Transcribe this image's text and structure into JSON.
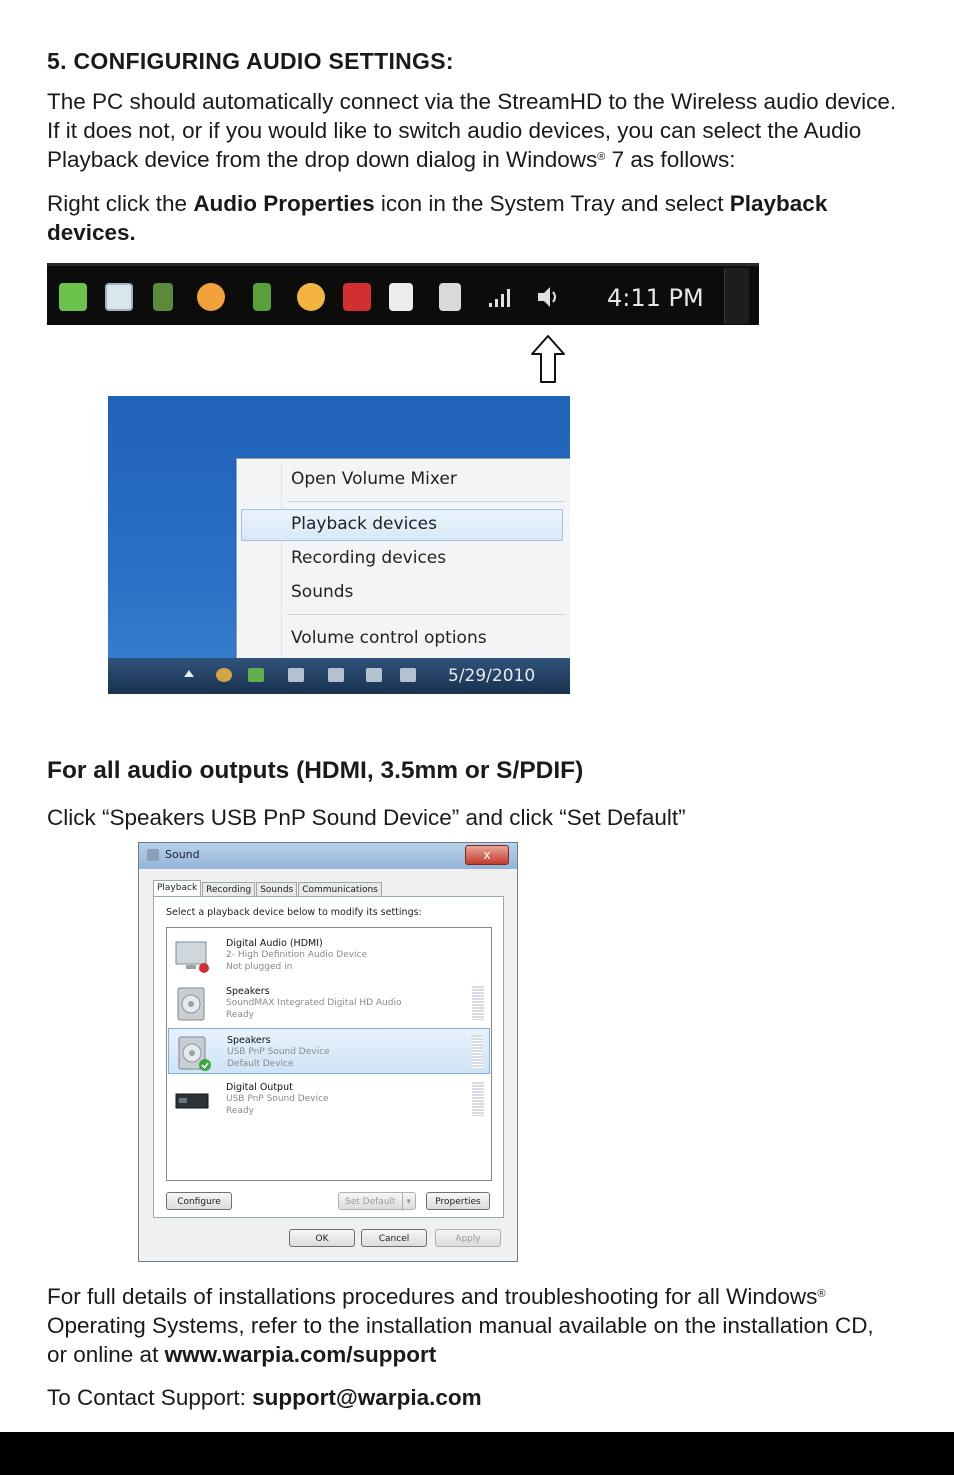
{
  "heading": "5. CONFIGURING  AUDIO SETTINGS:",
  "intro": {
    "line1": "The PC should automatically connect via the StreamHD to the Wireless audio device.",
    "line2": "If it does not, or if you would like to switch audio devices, you can select the Audio",
    "line3_pre": "Playback device from the drop down dialog in Windows",
    "reg": "®",
    "line3_post": " 7 as follows:"
  },
  "instruction": {
    "pre": "Right click the ",
    "bold1": "Audio Properties",
    "mid": " icon in the System Tray and select ",
    "bold2": "Playback",
    "bold3": "devices."
  },
  "tray": {
    "time": "4:11 PM"
  },
  "context_menu": {
    "items": [
      "Open Volume Mixer",
      "Playback devices",
      "Recording devices",
      "Sounds",
      "Volume control options"
    ],
    "date": "5/29/2010"
  },
  "section2": {
    "heading": "For all audio outputs (HDMI, 3.5mm or S/PDIF)",
    "instruction": "Click “Speakers USB PnP Sound Device” and click “Set Default”"
  },
  "sound_dialog": {
    "title": "Sound",
    "close": "x",
    "tabs": [
      "Playback",
      "Recording",
      "Sounds",
      "Communications"
    ],
    "instruction": "Select a playback device below to modify its settings:",
    "devices": [
      {
        "name": "Digital Audio (HDMI)",
        "sub": "2- High Definition Audio Device",
        "status": "Not plugged in"
      },
      {
        "name": "Speakers",
        "sub": "SoundMAX Integrated Digital HD Audio",
        "status": "Ready"
      },
      {
        "name": "Speakers",
        "sub": "USB PnP Sound Device",
        "status": "Default Device"
      },
      {
        "name": "Digital Output",
        "sub": "USB PnP Sound Device",
        "status": "Ready"
      }
    ],
    "buttons": {
      "configure": "Configure",
      "set_default": "Set Default",
      "properties": "Properties",
      "ok": "OK",
      "cancel": "Cancel",
      "apply": "Apply"
    }
  },
  "footer": {
    "line1_pre": "For full details of installations procedures and troubleshooting for all Windows",
    "reg": "®",
    "line2": "Operating Systems, refer to the installation manual available on the installation CD,",
    "line3_pre": "or online at ",
    "url": "www.warpia.com/support",
    "contact_pre": "To Contact Support:  ",
    "email": "support@warpia.com"
  }
}
